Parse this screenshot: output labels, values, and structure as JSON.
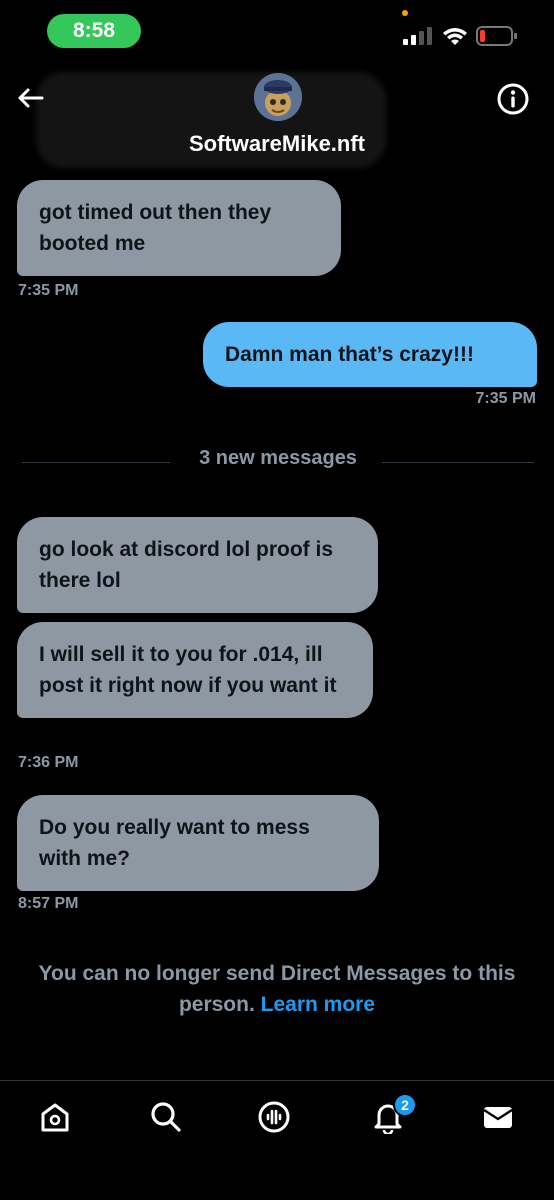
{
  "status_bar": {
    "time": "8:58",
    "icons": [
      "cellular-signal-icon",
      "wifi-icon",
      "battery-low-icon"
    ],
    "pill_color": "#34c759",
    "battery_color": "#ff3b30"
  },
  "header": {
    "contact_name": "SoftwareMike.nft",
    "icons": [
      "back-arrow-icon",
      "info-icon"
    ]
  },
  "conversation": {
    "messages": [
      {
        "text": "got timed out then they booted me",
        "direction": "received"
      },
      {
        "text": "Damn man that’s crazy!!!",
        "direction": "sent"
      },
      {
        "text": "go look at discord lol proof is there lol",
        "direction": "received"
      },
      {
        "text": "I will sell it to you for .014, ill post it right now if you want it",
        "direction": "received"
      },
      {
        "text": "Do you really want to mess with me?",
        "direction": "received"
      }
    ],
    "timestamps": [
      "7:35 PM",
      "7:35 PM",
      "7:36 PM",
      "8:57 PM"
    ],
    "new_messages_divider": "3 new messages",
    "received_bubble_color": "#8e98a3",
    "sent_bubble_color": "#5ab8f5"
  },
  "footer_notice": {
    "text": "You can no longer send Direct Messages to this person.",
    "link": "Learn more",
    "link_color": "#1d9bf0"
  },
  "bottom_nav": {
    "items": [
      "home-icon",
      "search-icon",
      "spaces-icon",
      "notifications-icon",
      "messages-icon"
    ],
    "notification_badge": "2"
  }
}
